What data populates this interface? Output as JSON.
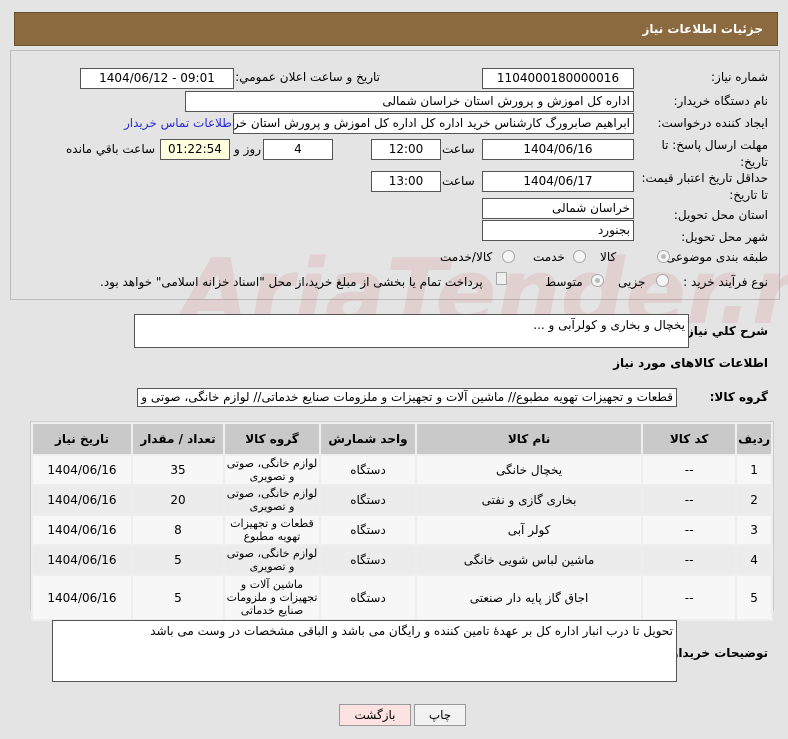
{
  "header": {
    "title": "جزئیات اطلاعات نیاز"
  },
  "form": {
    "need_number_label": "شماره نیاز:",
    "need_number": "1104000180000016",
    "announce_label": "تاریخ و ساعت اعلان عمومي:",
    "announce_value": "1404/06/12 - 09:01",
    "buyer_label": "نام دستگاه خریدار:",
    "buyer": "اداره کل اموزش و پرورش استان خراسان شمالی",
    "creator_label": "ایجاد کننده درخواست:",
    "creator": "ابراهیم صابرورگ کارشناس خرید اداره کل اداره کل اموزش و پرورش استان خراسا",
    "contact_link": "اطلاعات تماس خریدار",
    "deadline_label": "مهلت ارسال پاسخ: تا تاریخ:",
    "deadline_date": "1404/06/16",
    "time_label": "ساعت",
    "deadline_time": "12:00",
    "days": "4",
    "days_label": "روز و",
    "remaining": "01:22:54",
    "remaining_label": "ساعت باقي مانده",
    "validity_label": "حداقل تاریخ اعتبار قیمت: تا تاریخ:",
    "validity_date": "1404/06/17",
    "validity_time": "13:00",
    "province_label": "استان محل تحویل:",
    "province": "خراسان شمالی",
    "city_label": "شهر محل تحویل:",
    "city": "بجنورد",
    "category_label": "طبقه بندی موضوعی:",
    "category_options": [
      "کالا",
      "خدمت",
      "کالا/خدمت"
    ],
    "process_label": "نوع فرآیند خرید :",
    "process_options": [
      "جزیی",
      "متوسط"
    ],
    "payment_note": "پرداخت تمام یا بخشی از مبلغ خرید،از محل \"اسناد خزانه اسلامی\" خواهد بود."
  },
  "description": {
    "label": "شرح کلي نياز:",
    "value": "یخچال و بخاری و کولرآبی و ..."
  },
  "goods": {
    "section_title": "اطلاعات کالاهای مورد نیاز",
    "group_label": "گروه کالا:",
    "group_value": "قطعات و تجهیزات تهویه مطبوع// ماشین آلات و تجهیزات و ملزومات صنایع خدماتی// لوازم خانگی، صوتی و تص"
  },
  "table": {
    "headers": [
      "ردیف",
      "کد کالا",
      "نام کالا",
      "واحد شمارش",
      "گروه کالا",
      "تعداد / مقدار",
      "تاریخ نیاز"
    ],
    "rows": [
      [
        "1",
        "--",
        "یخچال خانگی",
        "دستگاه",
        "لوازم خانگی، صوتی و تصویری",
        "35",
        "1404/06/16"
      ],
      [
        "2",
        "--",
        "بخاری گازی و نفتی",
        "دستگاه",
        "لوازم خانگی، صوتی و تصویری",
        "20",
        "1404/06/16"
      ],
      [
        "3",
        "--",
        "کولر آبی",
        "دستگاه",
        "قطعات و تجهیزات تهویه مطبوع",
        "8",
        "1404/06/16"
      ],
      [
        "4",
        "--",
        "ماشین لباس شویی خانگی",
        "دستگاه",
        "لوازم خانگی، صوتی و تصویری",
        "5",
        "1404/06/16"
      ],
      [
        "5",
        "--",
        "اجاق گاز پایه دار صنعتی",
        "دستگاه",
        "ماشین آلات و تجهیزات و ملزومات صنایع خدماتی",
        "5",
        "1404/06/16"
      ]
    ]
  },
  "buyer_notes": {
    "label": "توضیحات خریدار:",
    "value": "تحویل تا درب انبار اداره کل بر عهدهٔ تامین کننده و رایگان می باشد و الباقی مشخصات در وست می باشد"
  },
  "buttons": {
    "print": "چاپ",
    "back": "بازگشت"
  }
}
